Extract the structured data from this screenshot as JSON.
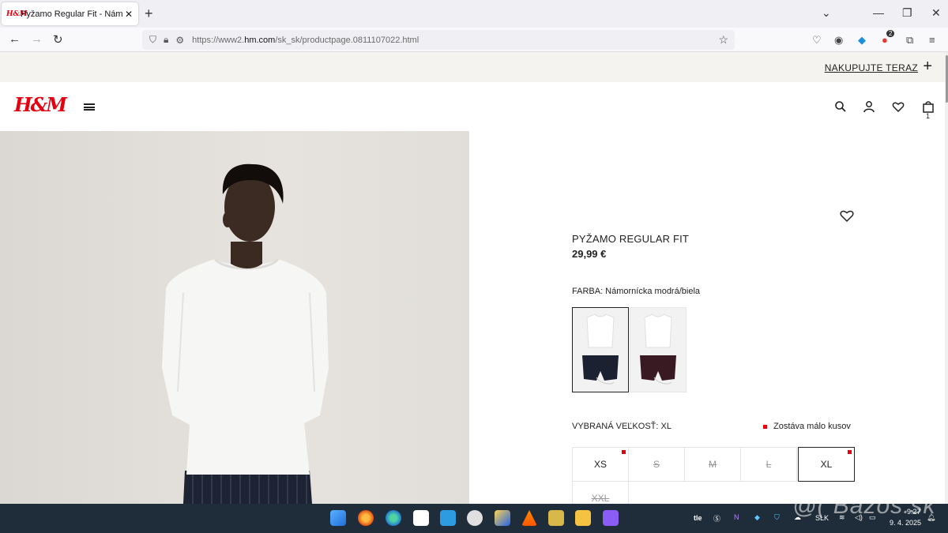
{
  "browser": {
    "tab_title": "Pyžamo Regular Fit - Námorníc",
    "tab_favicon": "H&M",
    "url_prefix": "https://www2.",
    "url_domain": "hm.com",
    "url_path": "/sk_sk/productpage.0811107022.html",
    "badge_count": "2"
  },
  "promo": {
    "link_label": "NAKUPUJTE TERAZ"
  },
  "header": {
    "logo": "H&M",
    "cart_count": "1"
  },
  "product": {
    "name": "PYŽAMO REGULAR FIT",
    "price": "29,99 €",
    "color_label": "FARBA: Námornícka modrá/biela",
    "size_label": "VYBRANÁ VEĽKOSŤ: XL",
    "stock_note": "Zostáva málo kusov",
    "sizes": [
      {
        "label": "XS",
        "state": "low"
      },
      {
        "label": "S",
        "state": "out"
      },
      {
        "label": "M",
        "state": "out"
      },
      {
        "label": "L",
        "state": "out"
      },
      {
        "label": "XL",
        "state": "selected-low"
      },
      {
        "label": "XXL",
        "state": "out"
      }
    ]
  },
  "taskbar": {
    "lang": "SLK",
    "time": "9:27",
    "date": "9. 4. 2025",
    "tray_label": "tle"
  },
  "watermark": "@( Bazos.sk",
  "colors": {
    "brand_red": "#e50010",
    "taskbar": "#1f2d3a",
    "promo_bg": "#f5f3f0"
  }
}
